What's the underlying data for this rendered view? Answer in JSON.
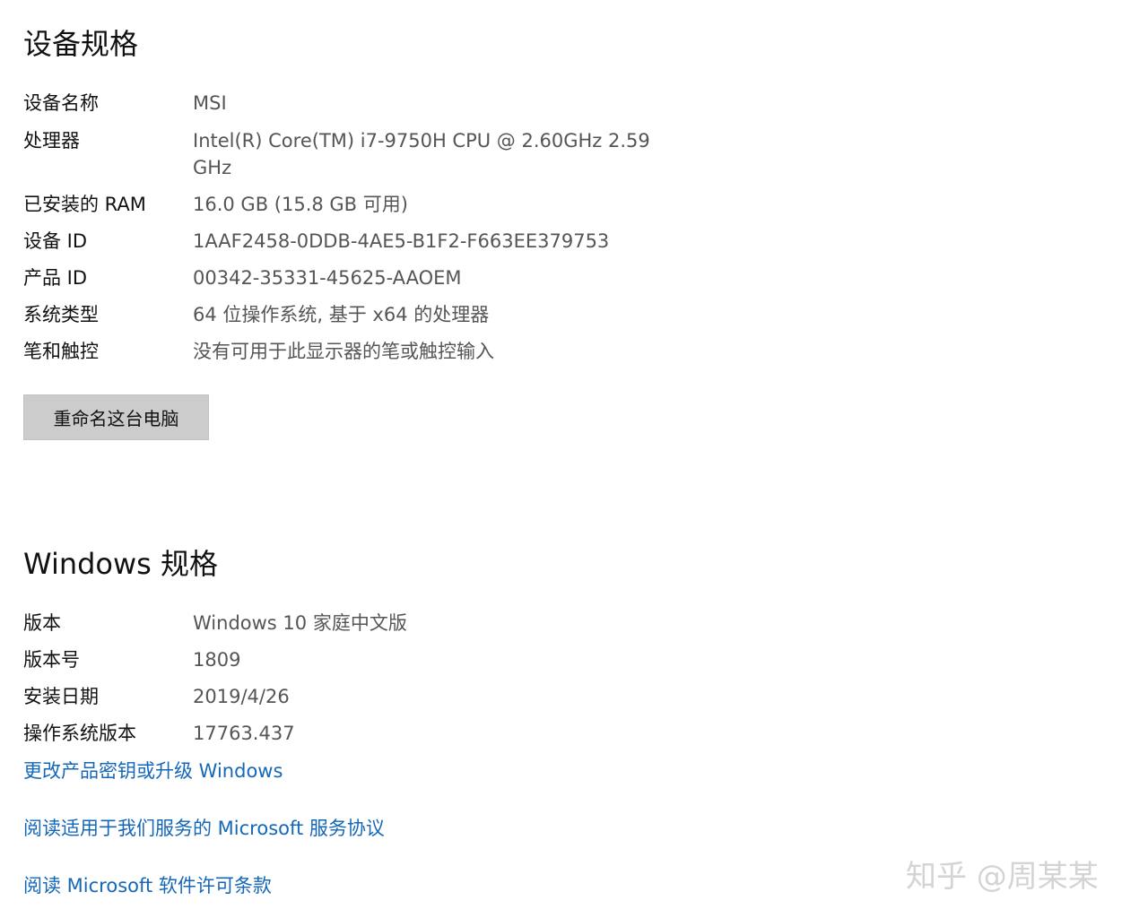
{
  "device_specs": {
    "title": "设备规格",
    "rows": [
      {
        "label": "设备名称",
        "value": "MSI"
      },
      {
        "label": "处理器",
        "value": "Intel(R) Core(TM) i7-9750H CPU @ 2.60GHz   2.59 GHz"
      },
      {
        "label": "已安装的 RAM",
        "value": "16.0 GB (15.8 GB 可用)"
      },
      {
        "label": "设备 ID",
        "value": "1AAF2458-0DDB-4AE5-B1F2-F663EE379753"
      },
      {
        "label": "产品 ID",
        "value": "00342-35331-45625-AAOEM"
      },
      {
        "label": "系统类型",
        "value": "64 位操作系统, 基于 x64 的处理器"
      },
      {
        "label": "笔和触控",
        "value": "没有可用于此显示器的笔或触控输入"
      }
    ],
    "rename_button_label": "重命名这台电脑"
  },
  "windows_specs": {
    "title": "Windows 规格",
    "rows": [
      {
        "label": "版本",
        "value": "Windows 10 家庭中文版"
      },
      {
        "label": "版本号",
        "value": "1809"
      },
      {
        "label": "安装日期",
        "value": "2019/4/26"
      },
      {
        "label": "操作系统版本",
        "value": "17763.437"
      }
    ]
  },
  "links": {
    "change_key": "更改产品密钥或升级 Windows",
    "services_agreement": "阅读适用于我们服务的 Microsoft 服务协议",
    "license_terms": "阅读 Microsoft 软件许可条款"
  },
  "watermark": "知乎 @周某某",
  "colors": {
    "link": "#1567b8",
    "value_text": "#555555",
    "button_bg": "#cccccc"
  }
}
